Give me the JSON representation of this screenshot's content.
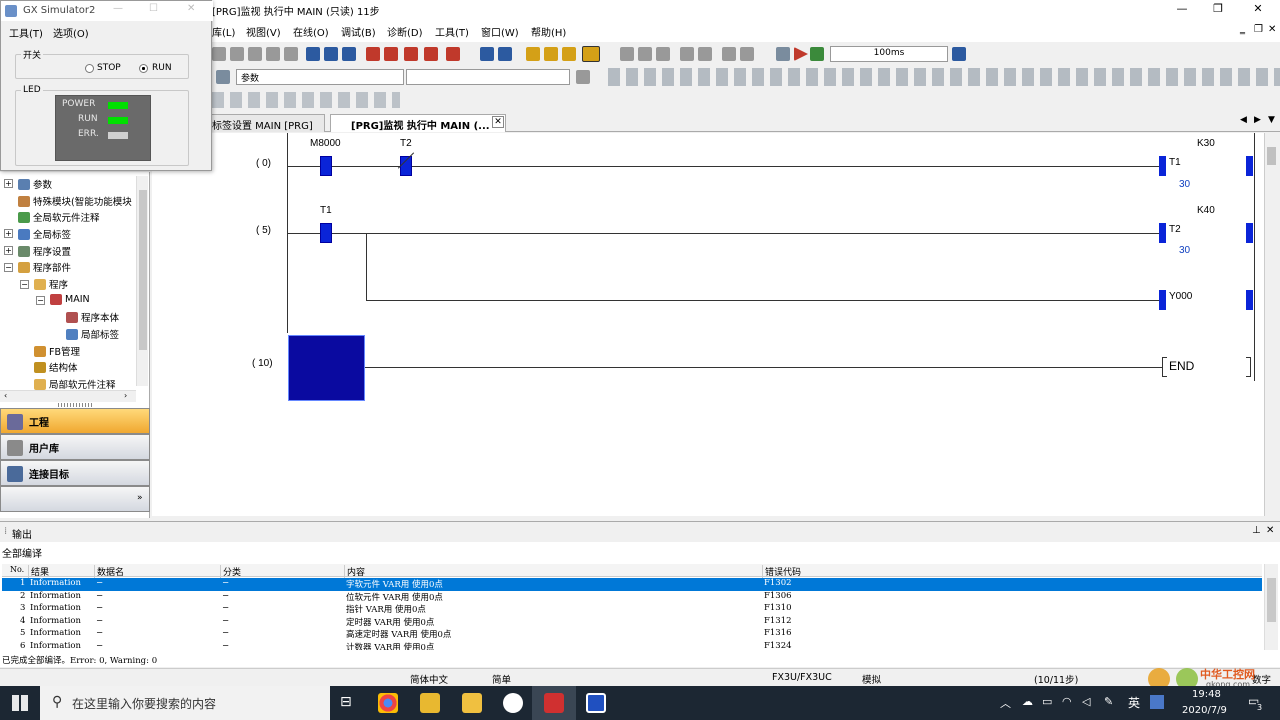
{
  "app": {
    "title": "[PRG]监视 执行中 MAIN (只读) 11步",
    "win_min": "—",
    "win_max": "❐",
    "win_close": "✕"
  },
  "menu": [
    {
      "label": "库(L)"
    },
    {
      "label": "视图(V)"
    },
    {
      "label": "在线(O)"
    },
    {
      "label": "调试(B)"
    },
    {
      "label": "诊断(D)"
    },
    {
      "label": "工具(T)"
    },
    {
      "label": "窗口(W)"
    },
    {
      "label": "帮助(H)"
    }
  ],
  "toolbar": {
    "scan_time": "100ms",
    "combo_param": "参数"
  },
  "tabs": [
    {
      "label": "标签设置 MAIN [PRG]"
    },
    {
      "label": "[PRG]监视 执行中 MAIN (..."
    }
  ],
  "simulator": {
    "title": "GX Simulator2",
    "menu_tool": "工具(T)",
    "menu_option": "选项(O)",
    "switch_label": "开关",
    "stop_label": "STOP",
    "run_label": "RUN",
    "run_selected": true,
    "led_label": "LED",
    "leds": [
      {
        "name": "POWER",
        "color": "#00e000"
      },
      {
        "name": "RUN",
        "color": "#00e000"
      },
      {
        "name": "ERR.",
        "color": "#d0d0d0"
      }
    ]
  },
  "tree": [
    {
      "label": "参数",
      "exp": "+"
    },
    {
      "label": "特殊模块(智能功能模块",
      "exp": ""
    },
    {
      "label": "全局软元件注释",
      "exp": ""
    },
    {
      "label": "全局标签",
      "exp": "+"
    },
    {
      "label": "程序设置",
      "exp": "+"
    },
    {
      "label": "程序部件",
      "exp": "−"
    },
    {
      "label": "程序",
      "exp": "−"
    },
    {
      "label": "MAIN",
      "exp": "−"
    },
    {
      "label": "程序本体",
      "exp": ""
    },
    {
      "label": "局部标签",
      "exp": ""
    },
    {
      "label": "FB管理",
      "exp": ""
    },
    {
      "label": "结构体",
      "exp": ""
    },
    {
      "label": "局部软元件注释",
      "exp": ""
    }
  ],
  "nav": [
    {
      "label": "工程"
    },
    {
      "label": "用户库"
    },
    {
      "label": "连接目标"
    }
  ],
  "ladder": {
    "rungs": [
      {
        "step": "( 0)",
        "contacts": [
          "M8000",
          "T2"
        ],
        "coil": "T1",
        "k": "K30",
        "value": "30"
      },
      {
        "step": "( 5)",
        "contacts": [
          "T1"
        ],
        "coil": "T2",
        "k": "K40",
        "value": "30"
      },
      {
        "coil": "Y000"
      },
      {
        "step": "( 10)",
        "end": "END"
      }
    ]
  },
  "output": {
    "title": "输出",
    "subtitle": "全部编译",
    "columns": [
      "No.",
      "结果",
      "数据名",
      "分类",
      "内容",
      "错误代码"
    ],
    "rows": [
      {
        "no": "1",
        "result": "Information",
        "data": "−",
        "cls": "−",
        "content": "字软元件 VAR用 使用0点",
        "code": "F1302"
      },
      {
        "no": "2",
        "result": "Information",
        "data": "−",
        "cls": "−",
        "content": "位软元件 VAR用 使用0点",
        "code": "F1306"
      },
      {
        "no": "3",
        "result": "Information",
        "data": "−",
        "cls": "−",
        "content": "指针 VAR用 使用0点",
        "code": "F1310"
      },
      {
        "no": "4",
        "result": "Information",
        "data": "−",
        "cls": "−",
        "content": "定时器 VAR用 使用0点",
        "code": "F1312"
      },
      {
        "no": "5",
        "result": "Information",
        "data": "−",
        "cls": "−",
        "content": "高速定时器 VAR用 使用0点",
        "code": "F1316"
      },
      {
        "no": "6",
        "result": "Information",
        "data": "−",
        "cls": "−",
        "content": "计数器 VAR用 使用0点",
        "code": "F1324"
      }
    ],
    "summary": "已完成全部编译。Error: 0, Warning: 0"
  },
  "status": {
    "lang": "简体中文",
    "mode": "简单",
    "cpu": "FX3U/FX3UC",
    "sim": "模拟",
    "steps": "(10/11步)",
    "numlock": "数字"
  },
  "taskbar": {
    "search_placeholder": "在这里输入你要搜索的内容",
    "ime": "英",
    "time": "19:48",
    "date": "2020/7/9",
    "notif": "3"
  },
  "watermark": {
    "brand": "中华工控网",
    "site": "gkong.com"
  }
}
